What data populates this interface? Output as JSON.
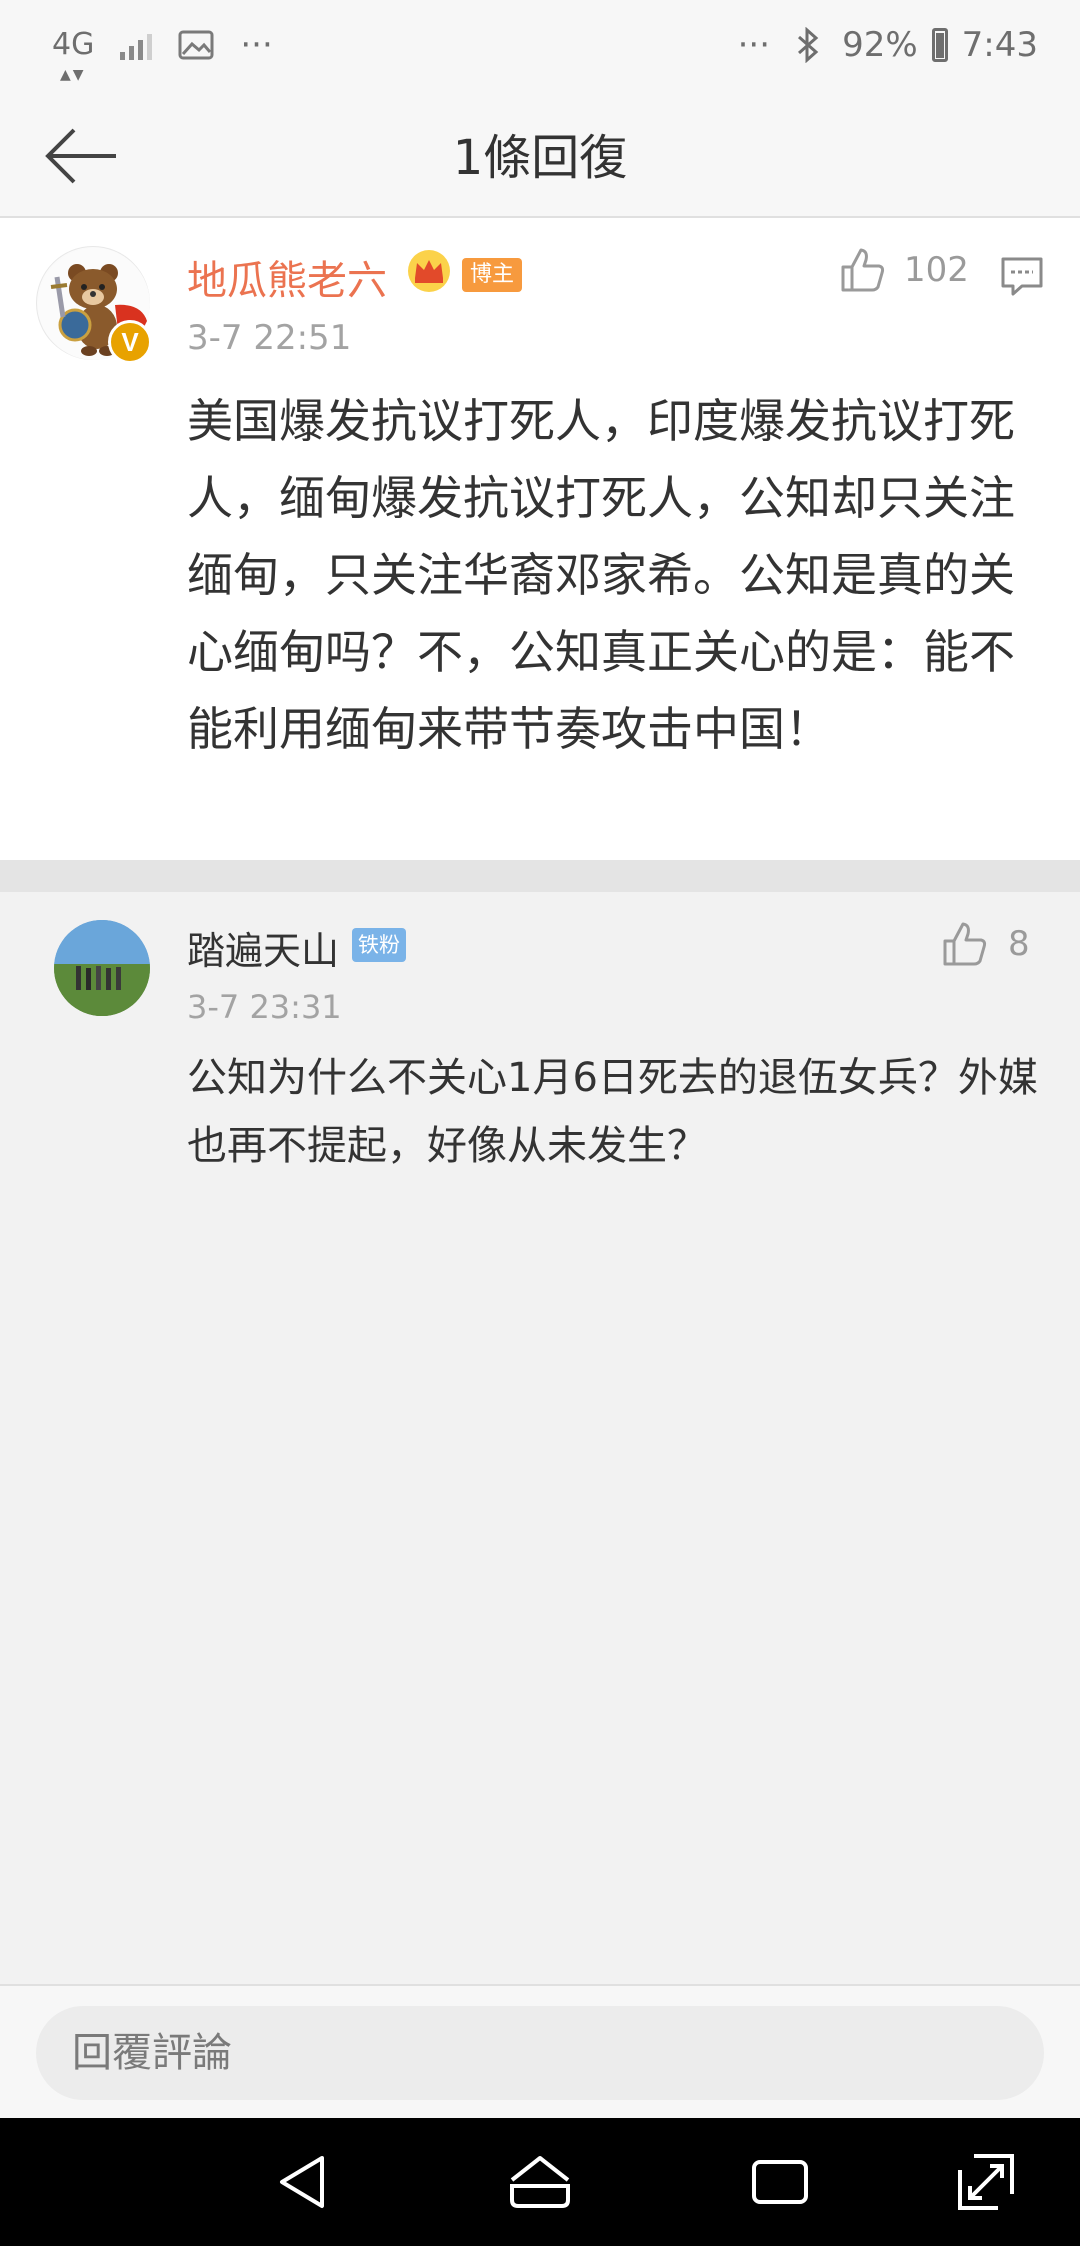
{
  "status_bar": {
    "network": "4G",
    "more_left": "···",
    "more_right": "···",
    "battery": "92%",
    "time": "7:43"
  },
  "header": {
    "title": "1條回復"
  },
  "main_comment": {
    "username": "地瓜熊老六",
    "badge": "博主",
    "verified": "V",
    "timestamp": "3-7 22:51",
    "likes": "102",
    "content": "美国爆发抗议打死人，印度爆发抗议打死人，缅甸爆发抗议打死人，公知却只关注缅甸，只关注华裔邓家希。公知是真的关心缅甸吗？不，公知真正关心的是：能不能利用缅甸来带节奏攻击中国！"
  },
  "reply": {
    "username": "踏遍天山",
    "badge": "铁粉",
    "timestamp": "3-7 23:31",
    "likes": "8",
    "content": "公知为什么不关心1月6日死去的退伍女兵？外媒也再不提起，好像从未发生？"
  },
  "input": {
    "placeholder": "回覆評論"
  },
  "colors": {
    "username_accent": "#eb7350",
    "blogger_badge": "#f79a3e",
    "fan_badge": "#7ab3e8",
    "verified_badge": "#e8a200"
  }
}
